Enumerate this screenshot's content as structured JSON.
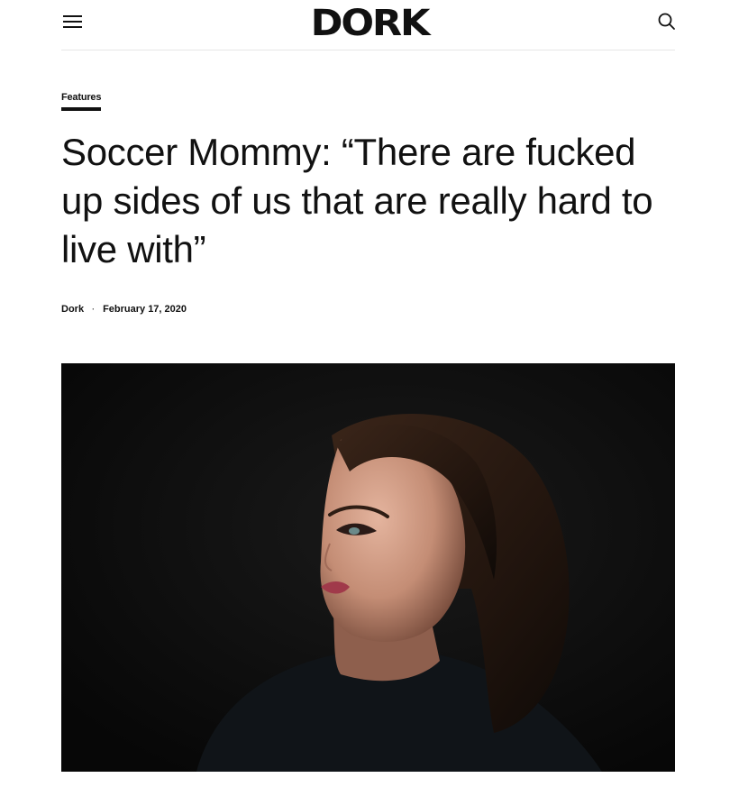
{
  "header": {
    "logo_text": "DORK",
    "menu_icon": "hamburger-menu-icon",
    "search_icon": "search-icon"
  },
  "article": {
    "category": "Features",
    "title": "Soccer Mommy: “There are fucked up sides of us that are really hard to live with”",
    "author": "Dork",
    "separator": "·",
    "date": "February 17, 2020"
  },
  "hero_image": {
    "description_icon": "portrait-photo"
  }
}
